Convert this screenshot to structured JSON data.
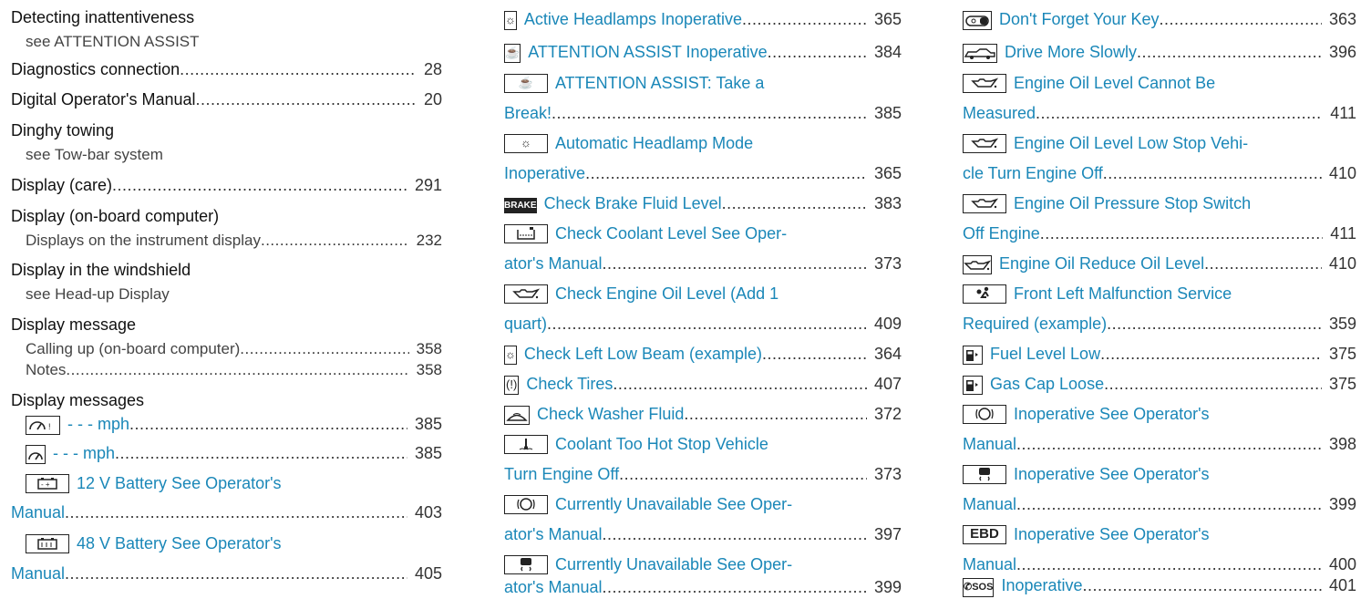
{
  "col1": {
    "detecting": {
      "title": "Detecting inattentiveness",
      "see": "see ATTENTION ASSIST"
    },
    "diagnostics": {
      "title": "Diagnostics connection",
      "page": "28"
    },
    "digital_manual": {
      "title": "Digital Operator's Manual",
      "page": "20"
    },
    "dinghy": {
      "title": "Dinghy towing",
      "see": "see Tow-bar system"
    },
    "display_care": {
      "title": "Display (care)",
      "page": "291"
    },
    "display_obc": {
      "title": "Display (on-board computer)",
      "sub": "Displays on the instrument display",
      "page": "232"
    },
    "display_windshield": {
      "title": "Display in the windshield",
      "see": "see Head-up Display"
    },
    "display_message": {
      "title": "Display message",
      "items": [
        {
          "text": "Calling up (on-board computer)",
          "page": "358"
        },
        {
          "text": "Notes",
          "page": "358"
        }
      ]
    },
    "display_messages": {
      "title": "Display messages",
      "items": [
        {
          "icon": "speedometer-warning-icon",
          "text": "- - - mph",
          "page": "385"
        },
        {
          "icon": "speedometer-icon",
          "text": "- - - mph",
          "page": "385"
        },
        {
          "icon": "battery-icon",
          "line1": "12 V Battery See Operator's",
          "line2": "Manual",
          "page": "403"
        },
        {
          "icon": "battery-48v-icon",
          "line1": "48 V Battery See Operator's",
          "line2": "Manual",
          "page": "405"
        }
      ]
    }
  },
  "col2": {
    "items": [
      {
        "icon": "headlamp-sun-icon",
        "text": "Active Headlamps Inoperative",
        "page": "365"
      },
      {
        "icon": "coffee-cup-icon",
        "text": "ATTENTION ASSIST Inoperative",
        "page": "384"
      },
      {
        "icon": "coffee-cup-icon",
        "line1": "ATTENTION ASSIST: Take a",
        "line2": "Break!",
        "page": "385"
      },
      {
        "icon": "headlamp-sun-icon",
        "line1": "Automatic Headlamp Mode",
        "line2": "Inoperative",
        "page": "365"
      },
      {
        "icon": "brake-icon",
        "icon_text": "BRAKE",
        "text": "Check Brake Fluid Level",
        "page": "383"
      },
      {
        "icon": "coolant-reservoir-icon",
        "line1": "Check Coolant Level See Oper-",
        "line2": "ator's Manual",
        "page": "373"
      },
      {
        "icon": "oil-can-icon",
        "line1": "Check Engine Oil Level (Add 1",
        "line2": "quart)",
        "page": "409"
      },
      {
        "icon": "headlamp-sun-icon",
        "text": "Check Left Low Beam (example)",
        "page": "364"
      },
      {
        "icon": "tire-pressure-icon",
        "text": "Check Tires",
        "page": "407"
      },
      {
        "icon": "washer-fluid-icon",
        "text": "Check Washer Fluid",
        "page": "372"
      },
      {
        "icon": "coolant-temperature-icon",
        "line1": "Coolant Too Hot Stop Vehicle",
        "line2": "Turn Engine Off",
        "page": "373"
      },
      {
        "icon": "abs-icon",
        "line1": "Currently Unavailable See Oper-",
        "line2": "ator's Manual",
        "page": "397"
      },
      {
        "icon": "skid-car-icon",
        "line1": "Currently Unavailable See Oper-",
        "line2": "ator's Manual",
        "page": "399"
      }
    ]
  },
  "col3": {
    "items": [
      {
        "icon": "key-icon",
        "text": "Don't Forget Your Key",
        "page": "363"
      },
      {
        "icon": "car-slow-icon",
        "text": "Drive More Slowly",
        "page": "396"
      },
      {
        "icon": "oil-can-icon",
        "line1": "Engine Oil Level Cannot Be",
        "line2": "Measured",
        "page": "411"
      },
      {
        "icon": "oil-can-icon",
        "line1": "Engine Oil Level Low Stop Vehi-",
        "line2": "cle Turn Engine Off",
        "page": "410"
      },
      {
        "icon": "oil-can-icon",
        "line1": "Engine Oil Pressure Stop Switch",
        "line2": "Off Engine",
        "page": "411"
      },
      {
        "icon": "oil-can-icon",
        "text": "Engine Oil Reduce Oil Level",
        "page": "410"
      },
      {
        "icon": "airbag-icon",
        "line1": "Front Left Malfunction Service",
        "line2": "Required (example)",
        "page": "359"
      },
      {
        "icon": "fuel-pump-icon",
        "text": "Fuel Level Low",
        "page": "375"
      },
      {
        "icon": "fuel-pump-icon",
        "text": "Gas Cap Loose",
        "page": "375"
      },
      {
        "icon": "abs-icon",
        "line1": "Inoperative See Operator's",
        "line2": "Manual",
        "page": "398"
      },
      {
        "icon": "skid-car-icon",
        "line1": "Inoperative See Operator's",
        "line2": "Manual",
        "page": "399"
      },
      {
        "icon": "ebd-icon",
        "icon_text": "EBD",
        "line1": "Inoperative See Operator's",
        "line2": "Manual",
        "page": "400"
      },
      {
        "icon": "sos-icon",
        "icon_text": "SOS",
        "text": "Inoperative",
        "page": "401"
      }
    ]
  },
  "colors": {
    "link": "#1a87b8",
    "text": "#1a1a1a",
    "icon": "#222222"
  }
}
